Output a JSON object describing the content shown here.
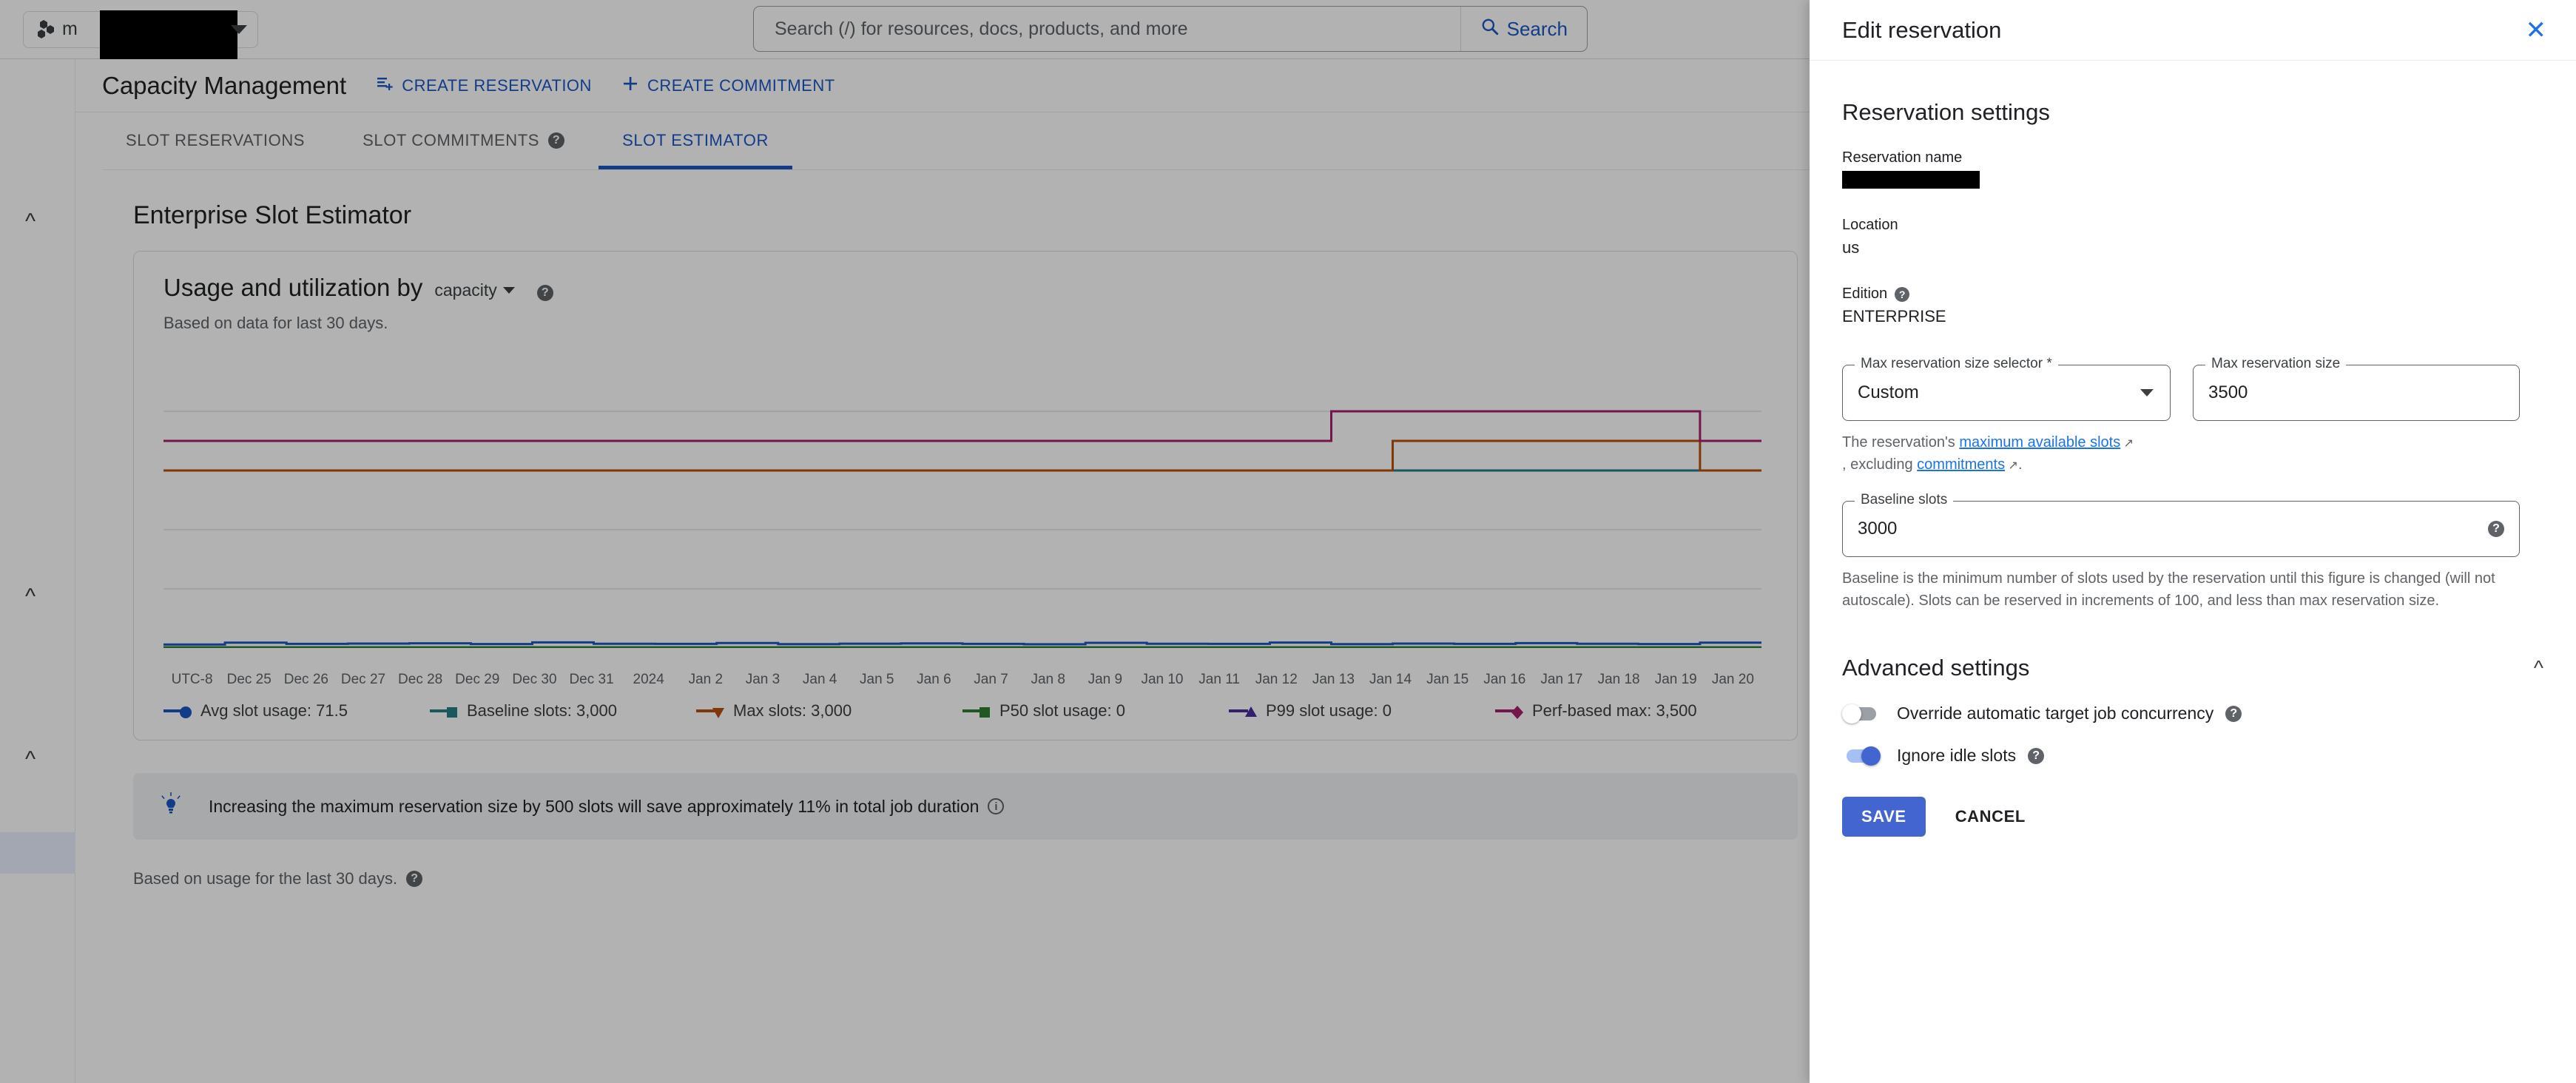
{
  "topbar": {
    "project_name": "m",
    "project_icon": "cloud-project-icon",
    "caret_icon": "chevron-down-icon",
    "search_placeholder": "Search (/) for resources, docs, products, and more",
    "search_button_label": "Search",
    "search_icon": "search-icon"
  },
  "page": {
    "title": "Capacity Management",
    "actions": [
      {
        "label": "CREATE RESERVATION",
        "icon": "reservation-add-icon"
      },
      {
        "label": "CREATE COMMITMENT",
        "icon": "plus-icon"
      }
    ],
    "tabs": [
      {
        "label": "SLOT RESERVATIONS",
        "active": false,
        "help": false
      },
      {
        "label": "SLOT COMMITMENTS",
        "active": false,
        "help": true
      },
      {
        "label": "SLOT ESTIMATOR",
        "active": true,
        "help": false
      }
    ],
    "estimator_title": "Enterprise Slot Estimator",
    "card": {
      "heading": "Usage and utilization by",
      "dropdown_value": "capacity",
      "help_icon": "help-icon",
      "subtitle": "Based on data for last 30 days."
    },
    "tip": {
      "icon": "lightbulb-icon",
      "text": "Increasing the maximum reservation size by 500 slots will save approximately 11% in total job duration",
      "info_icon": "info-icon"
    },
    "footer_note": "Based on usage for the last 30 days.",
    "footer_help_icon": "help-icon"
  },
  "chart_data": {
    "type": "line",
    "title": "Usage and utilization by capacity",
    "subtitle": "Based on data for last 30 days.",
    "xlabel": "",
    "ylabel": "",
    "grid": true,
    "legend_position": "bottom",
    "timezone_label": "UTC-8",
    "x": [
      "Dec 25",
      "Dec 26",
      "Dec 27",
      "Dec 28",
      "Dec 29",
      "Dec 30",
      "Dec 31",
      "2024",
      "Jan 2",
      "Jan 3",
      "Jan 4",
      "Jan 5",
      "Jan 6",
      "Jan 7",
      "Jan 8",
      "Jan 9",
      "Jan 10",
      "Jan 11",
      "Jan 12",
      "Jan 13",
      "Jan 14",
      "Jan 15",
      "Jan 16",
      "Jan 17",
      "Jan 18",
      "Jan 19",
      "Jan 20"
    ],
    "ylim": [
      0,
      5000
    ],
    "series": [
      {
        "name": "Avg slot usage",
        "legend_label": "Avg slot usage: 71.5",
        "value": 71.5,
        "color": "#1a56c4",
        "marker": "circle",
        "values": [
          60,
          90,
          70,
          75,
          80,
          68,
          95,
          72,
          70,
          85,
          66,
          74,
          78,
          70,
          64,
          88,
          72,
          70,
          92,
          66,
          75,
          70,
          82,
          71,
          68,
          90,
          71.5
        ]
      },
      {
        "name": "Baseline slots",
        "legend_label": "Baseline slots: 3,000",
        "value": 3000,
        "color": "#287d86",
        "marker": "square",
        "values": [
          3000,
          3000,
          3000,
          3000,
          3000,
          3000,
          3000,
          3000,
          3000,
          3000,
          3000,
          3000,
          3000,
          3000,
          3000,
          3000,
          3000,
          3000,
          3000,
          3000,
          3000,
          3000,
          3000,
          3000,
          3000,
          3000,
          3000
        ]
      },
      {
        "name": "Max slots",
        "legend_label": "Max slots: 3,000",
        "value": 3000,
        "color": "#b8500f",
        "marker": "triangle-down",
        "values": [
          3000,
          3000,
          3000,
          3000,
          3000,
          3000,
          3000,
          3000,
          3000,
          3000,
          3000,
          3000,
          3000,
          3000,
          3000,
          3000,
          3000,
          3000,
          3000,
          3000,
          3500,
          3500,
          3500,
          3500,
          3500,
          3000,
          3000
        ]
      },
      {
        "name": "P50 slot usage",
        "legend_label": "P50 slot usage: 0",
        "value": 0,
        "color": "#2e7d32",
        "marker": "square",
        "values": [
          0,
          0,
          0,
          0,
          0,
          0,
          0,
          0,
          0,
          0,
          0,
          0,
          0,
          0,
          0,
          0,
          0,
          0,
          0,
          0,
          0,
          0,
          0,
          0,
          0,
          0,
          0
        ]
      },
      {
        "name": "P99 slot usage",
        "legend_label": "P99 slot usage: 0",
        "value": 0,
        "color": "#4a2ba0",
        "marker": "triangle-up",
        "values": [
          0,
          0,
          0,
          0,
          0,
          0,
          0,
          0,
          0,
          0,
          0,
          0,
          0,
          0,
          0,
          0,
          0,
          0,
          0,
          0,
          0,
          0,
          0,
          0,
          0,
          0,
          0
        ]
      },
      {
        "name": "Perf-based max",
        "legend_label": "Perf-based max: 3,500",
        "value": 3500,
        "color": "#a61f6e",
        "marker": "diamond",
        "values": [
          3500,
          3500,
          3500,
          3500,
          3500,
          3500,
          3500,
          3500,
          3500,
          3500,
          3500,
          3500,
          3500,
          3500,
          3500,
          3500,
          3500,
          3500,
          3500,
          4000,
          4000,
          4000,
          4000,
          4000,
          4000,
          3500,
          3500
        ]
      }
    ]
  },
  "panel": {
    "title": "Edit reservation",
    "close_icon": "close-icon",
    "section_title": "Reservation settings",
    "reservation_name_label": "Reservation name",
    "reservation_name_value": "",
    "location_label": "Location",
    "location_value": "us",
    "edition_label": "Edition",
    "edition_help_icon": "help-icon",
    "edition_value": "ENTERPRISE",
    "max_selector_label": "Max reservation size selector *",
    "max_selector_value": "Custom",
    "max_selector_caret": "chevron-down-icon",
    "max_size_label": "Max reservation size",
    "max_size_value": "3500",
    "hint_prefix": "The reservation's ",
    "hint_link1": "maximum available slots",
    "hint_middle": ", excluding ",
    "hint_link2": "commitments",
    "hint_suffix": ".",
    "baseline_label": "Baseline slots",
    "baseline_value": "3000",
    "baseline_help_icon": "help-icon",
    "baseline_hint": "Baseline is the minimum number of slots used by the reservation until this figure is changed (will not autoscale). Slots can be reserved in increments of 100, and less than max reservation size.",
    "advanced_title": "Advanced settings",
    "advanced_chevron": "chevron-up-icon",
    "toggles": [
      {
        "label": "Override automatic target job concurrency",
        "on": false,
        "help_icon": "help-icon"
      },
      {
        "label": "Ignore idle slots",
        "on": true,
        "help_icon": "help-icon"
      }
    ],
    "save_label": "SAVE",
    "cancel_label": "CANCEL"
  },
  "colors": {
    "accent": "#1a73e8",
    "button": "#4365d0",
    "text": "#202124",
    "muted": "#5f6368"
  }
}
